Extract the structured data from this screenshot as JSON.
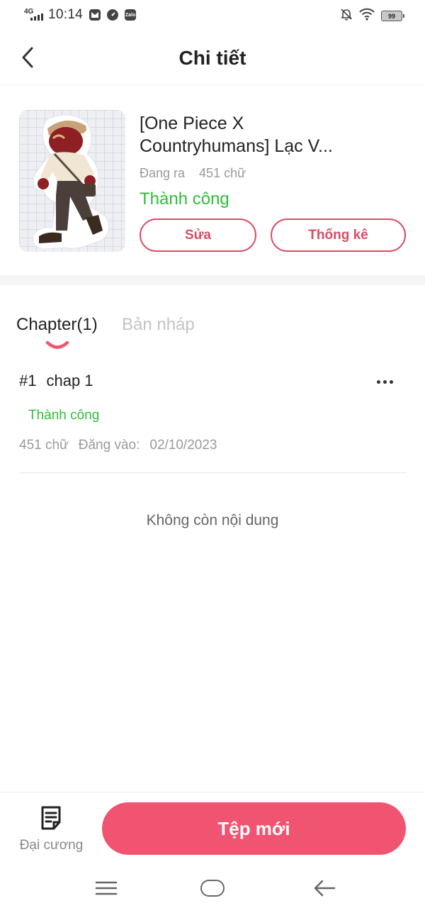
{
  "status_bar": {
    "network": "4G",
    "time": "10:14",
    "app_icons": [
      "gmail-icon",
      "speedometer-icon",
      "zalo-icon"
    ],
    "zalo_label": "Zalo",
    "battery": "99"
  },
  "header": {
    "title": "Chi tiết"
  },
  "book": {
    "title_line1": "[One Piece X",
    "title_line2": "Countryhumans] Lạc V...",
    "state": "Đang ra",
    "word_count": "451 chữ",
    "status": "Thành công",
    "edit_label": "Sửa",
    "stats_label": "Thống kê"
  },
  "tabs": [
    {
      "label": "Chapter(1)",
      "active": true
    },
    {
      "label": "Bản nháp",
      "active": false
    }
  ],
  "chapters": [
    {
      "number": "#1",
      "title": "chap 1",
      "status": "Thành công",
      "word_count": "451 chữ",
      "posted_label": "Đăng vào:",
      "posted_date": "02/10/2023"
    }
  ],
  "empty_message": "Không còn nội dung",
  "bottom_bar": {
    "outline_label": "Đại cương",
    "new_file_label": "Tệp mới"
  },
  "colors": {
    "accent": "#f05470",
    "accent_outline": "#d94d64",
    "success": "#2fbe3a",
    "muted": "#9a9a9a"
  }
}
